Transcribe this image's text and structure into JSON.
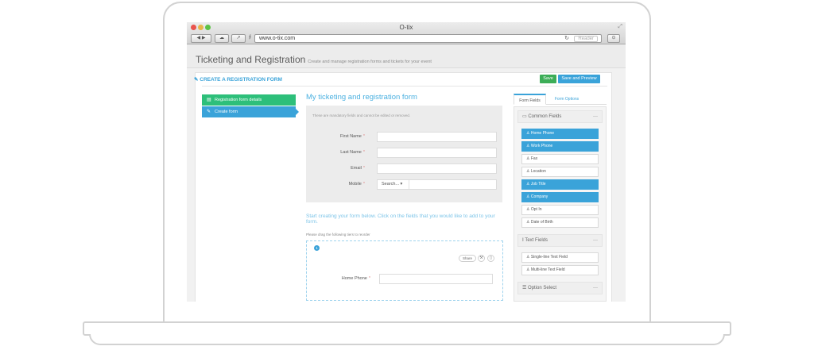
{
  "browser": {
    "window_title": "O-tix",
    "url": "www.o-tix.com",
    "reader_label": "Reader"
  },
  "header": {
    "title": "Ticketing and Registration",
    "subtitle": "Create and manage registration forms and tickets for your event"
  },
  "card": {
    "title": "CREATE A REGISTRATION FORM",
    "save_label": "Save",
    "save_preview_label": "Save and Preview"
  },
  "steps": [
    {
      "label": "Registration form details"
    },
    {
      "label": "Create form"
    }
  ],
  "form": {
    "heading": "My ticketing and registration form",
    "mandatory_note": "These are mandatory fields and cannot be edited or removed.",
    "fields": [
      {
        "label": "First Name",
        "required_mark": "*"
      },
      {
        "label": "Last Name",
        "required_mark": "*"
      },
      {
        "label": "Email",
        "required_mark": "*"
      },
      {
        "label": "Mobile",
        "required_mark": "*",
        "select_value": "Search..."
      }
    ],
    "start_text": "Start creating your form below. Click on the fields that you would like to add to your form.",
    "drag_note": "Please drag the following tiers to reorder",
    "tier": {
      "number": "1",
      "share_label": "Share",
      "field_label": "Home Phone",
      "required_mark": "*"
    }
  },
  "panel": {
    "tabs": [
      {
        "label": "Form Fields"
      },
      {
        "label": "Form Options"
      }
    ],
    "common_fields": {
      "title": "Common Fields",
      "items": [
        {
          "label": "Home Phone",
          "selected": true
        },
        {
          "label": "Work Phone",
          "selected": true
        },
        {
          "label": "Fax",
          "selected": false
        },
        {
          "label": "Location",
          "selected": false
        },
        {
          "label": "Job Title",
          "selected": true
        },
        {
          "label": "Company",
          "selected": true
        },
        {
          "label": "Opt In",
          "selected": false
        },
        {
          "label": "Date of Birth",
          "selected": false
        }
      ]
    },
    "text_fields": {
      "title": "Text Fields",
      "items": [
        {
          "label": "Single-line Text Field"
        },
        {
          "label": "Multi-line Text Field"
        }
      ]
    },
    "option_select": {
      "title": "Option Select"
    }
  },
  "colors": {
    "accent": "#3aa3d9",
    "success": "#3cad57",
    "step_done": "#2dbf7a"
  }
}
